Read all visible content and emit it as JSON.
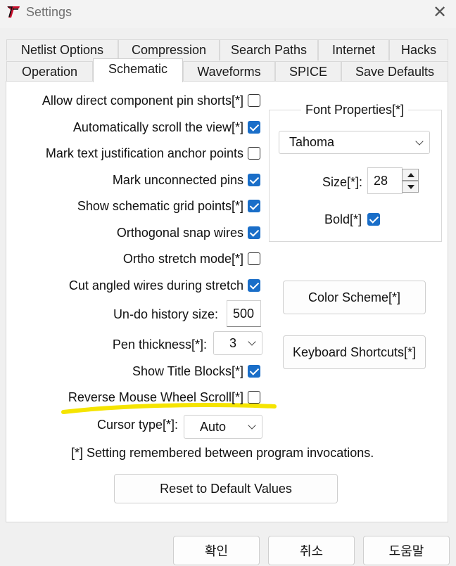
{
  "window": {
    "title": "Settings",
    "app_icon": "ltspice-logo-icon",
    "close_icon": "close-icon"
  },
  "tabs": {
    "row1": [
      "Netlist Options",
      "Compression",
      "Search Paths",
      "Internet",
      "Hacks"
    ],
    "row2": [
      "Operation",
      "Schematic",
      "Waveforms",
      "SPICE",
      "Save Defaults"
    ],
    "active": "Schematic"
  },
  "options": [
    {
      "label": "Allow direct component pin shorts[*]",
      "checked": false
    },
    {
      "label": "Automatically scroll the view[*]",
      "checked": true
    },
    {
      "label": "Mark text justification anchor points",
      "checked": false
    },
    {
      "label": "Mark unconnected pins",
      "checked": true
    },
    {
      "label": "Show schematic grid points[*]",
      "checked": true
    },
    {
      "label": "Orthogonal snap wires",
      "checked": true
    },
    {
      "label": "Ortho stretch mode[*]",
      "checked": false
    },
    {
      "label": "Cut angled wires during stretch",
      "checked": true
    },
    {
      "label": "Show Title Blocks[*]",
      "checked": true
    },
    {
      "label": "Reverse Mouse Wheel Scroll[*]",
      "checked": false
    }
  ],
  "undo": {
    "label": "Un-do history size:",
    "value": "500"
  },
  "pen": {
    "label": "Pen thickness[*]:",
    "value": "3"
  },
  "cursor": {
    "label": "Cursor type[*]:",
    "value": "Auto"
  },
  "font": {
    "group_title": "Font Properties[*]",
    "family": "Tahoma",
    "size_label": "Size[*]:",
    "size_value": "28",
    "bold_label": "Bold[*]",
    "bold_checked": true
  },
  "buttons": {
    "color_scheme": "Color Scheme[*]",
    "keyboard_shortcuts": "Keyboard Shortcuts[*]",
    "reset": "Reset to Default Values",
    "ok": "확인",
    "cancel": "취소",
    "help": "도움말"
  },
  "note": "[*] Setting remembered between program invocations.",
  "highlight_color": "#f5e400",
  "accent_color": "#1a6ec8"
}
